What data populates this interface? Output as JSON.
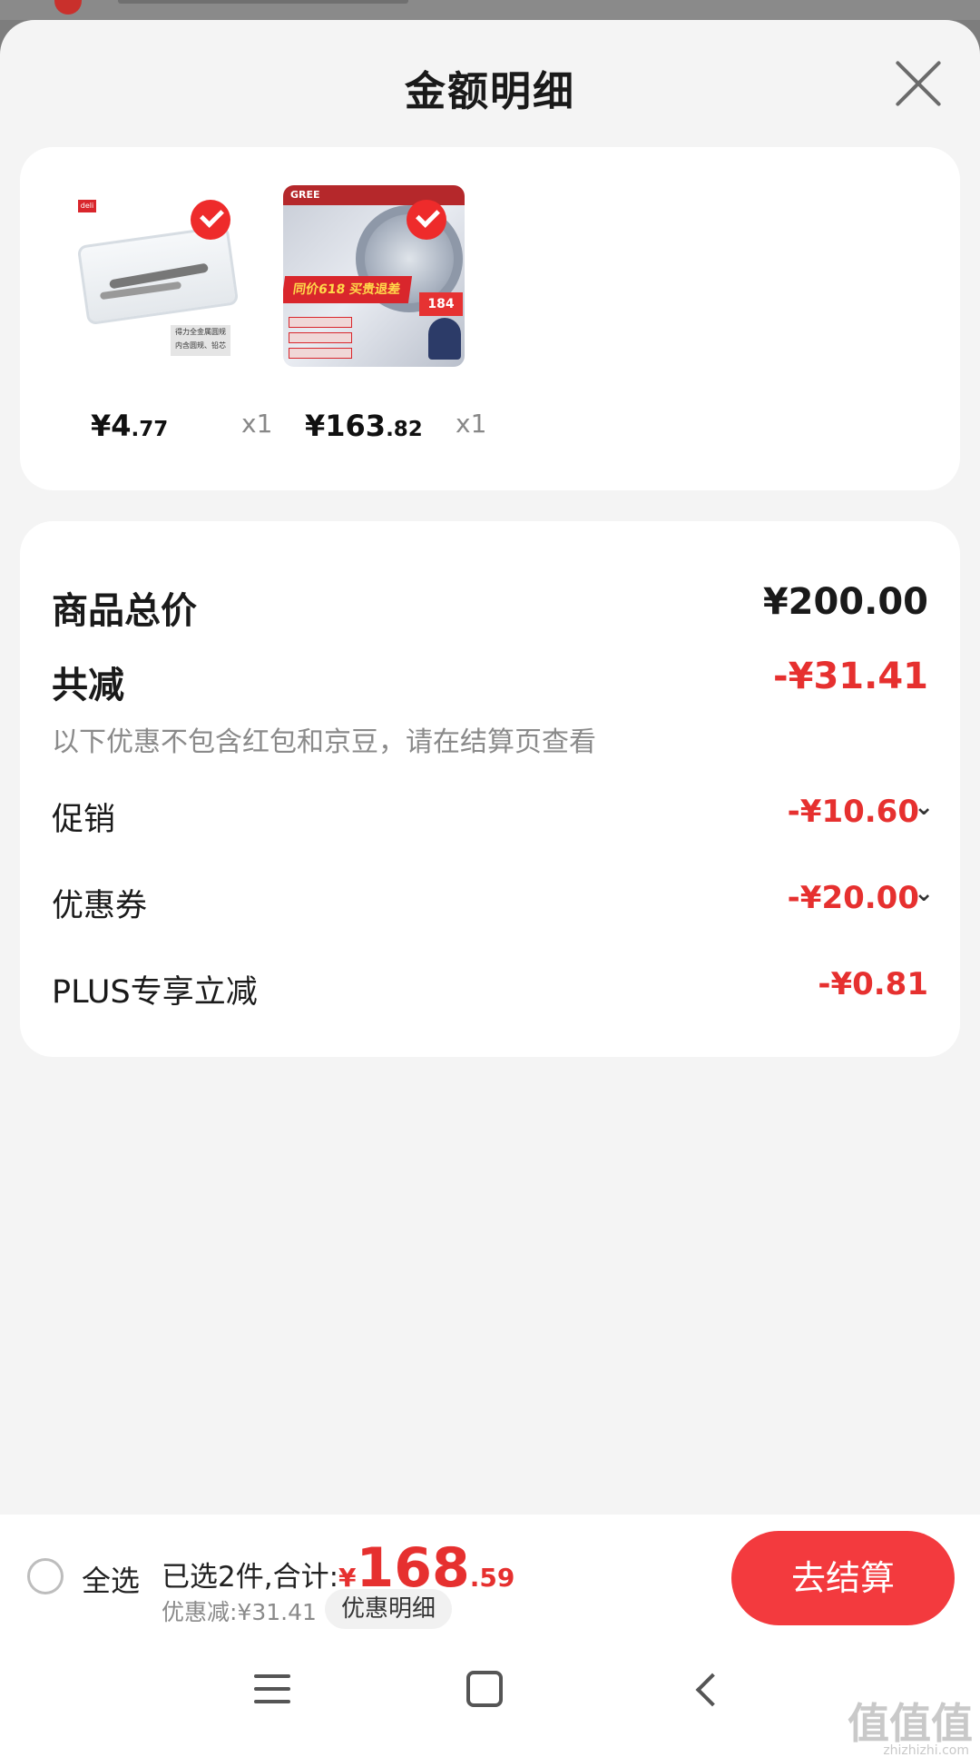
{
  "header": {
    "title": "金额明细"
  },
  "products": [
    {
      "price_int": "¥4",
      "price_dec": ".77",
      "qty": "x1",
      "brand": "deli",
      "label": "得力全金属圆规 内含圆规、铅芯"
    },
    {
      "price_int": "¥163",
      "price_dec": ".82",
      "qty": "x1",
      "brand": "GREE",
      "promo": "同价618 买贵退差",
      "promo_price": "184"
    }
  ],
  "details": {
    "total_label": "商品总价",
    "total_value": "¥200.00",
    "reduce_label": "共减",
    "reduce_value": "-¥31.41",
    "note": "以下优惠不包含红包和京豆，请在结算页查看",
    "items": [
      {
        "label": "促销",
        "value": "-¥10.60"
      },
      {
        "label": "优惠券",
        "value": "-¥20.00"
      },
      {
        "label": "PLUS专享立减",
        "value": "-¥0.81"
      }
    ]
  },
  "bottom": {
    "select_all": "全选",
    "selected_text": "已选2件,合计:",
    "yen": "¥",
    "total_big": "168",
    "total_small": ".59",
    "discount": "优惠减:¥31.41",
    "detail_btn": "优惠明细",
    "checkout": "去结算"
  },
  "watermark": {
    "main": "值值值",
    "site": "zhizhizhi.com"
  },
  "colors": {
    "accent": "#e6302f",
    "checkout": "#f33a3e"
  }
}
